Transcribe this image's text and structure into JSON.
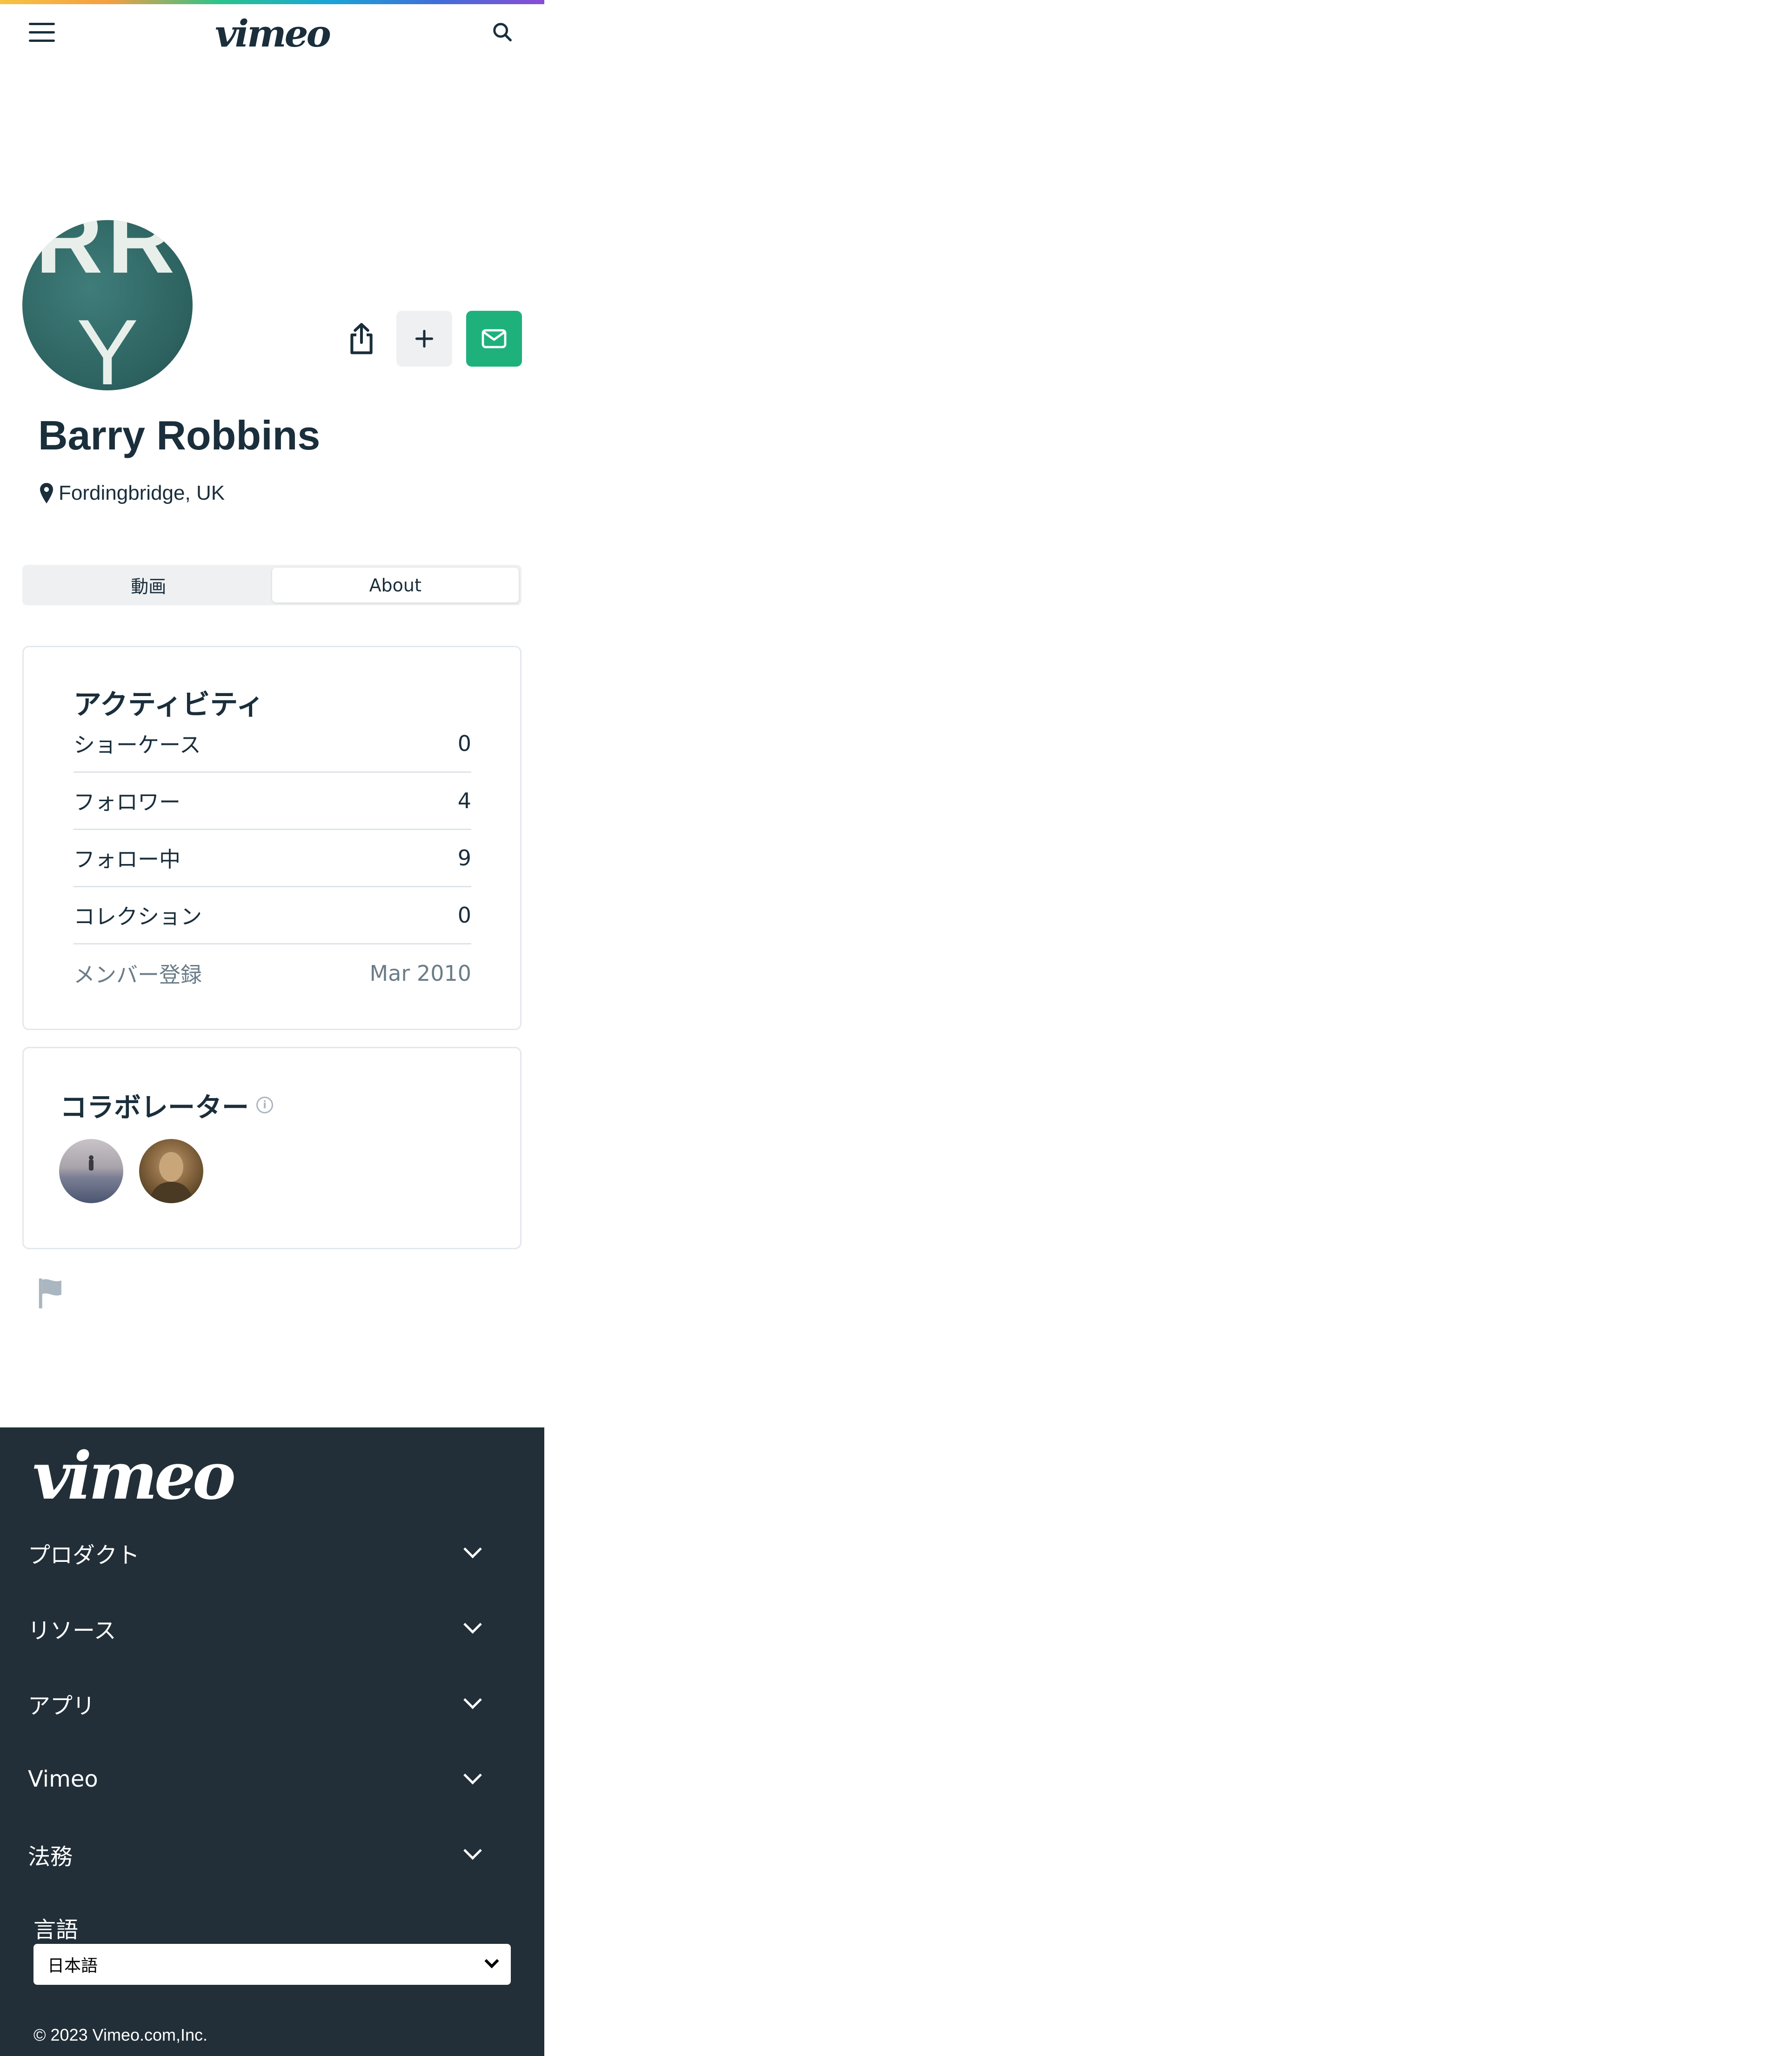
{
  "header": {
    "logo": "vimeo",
    "icons": [
      "hamburger-menu-icon",
      "search-icon"
    ]
  },
  "profile": {
    "avatar_letters_top": "RR",
    "avatar_letters_bottom": "Y",
    "name": "Barry Robbins",
    "location": "Fordingbridge, UK",
    "actions": [
      "share-icon",
      "plus-icon",
      "mail-icon"
    ]
  },
  "tabs": [
    {
      "label": "動画",
      "active": false
    },
    {
      "label": "About",
      "active": true
    }
  ],
  "activity": {
    "title": "アクティビティ",
    "rows": [
      {
        "label": "ショーケース",
        "value": "0"
      },
      {
        "label": "フォロワー",
        "value": "4"
      },
      {
        "label": "フォロー中",
        "value": "9"
      },
      {
        "label": "コレクション",
        "value": "0"
      },
      {
        "label": "メンバー登録",
        "value": "Mar 2010"
      }
    ]
  },
  "collaborators": {
    "title": "コラボレーター",
    "info_icon": "i",
    "count_shown": 2
  },
  "footer": {
    "logo": "vimeo",
    "sections": [
      {
        "label": "プロダクト"
      },
      {
        "label": "リソース"
      },
      {
        "label": "アプリ"
      },
      {
        "label": "Vimeo"
      },
      {
        "label": "法務"
      }
    ],
    "language_label": "言語",
    "language_value": "日本語",
    "copyright": "© 2023 Vimeo.com,Inc."
  },
  "colors": {
    "brand_dark": "#1a2e3b",
    "footer_bg": "#222f38",
    "message_button": "#1eb17c"
  }
}
